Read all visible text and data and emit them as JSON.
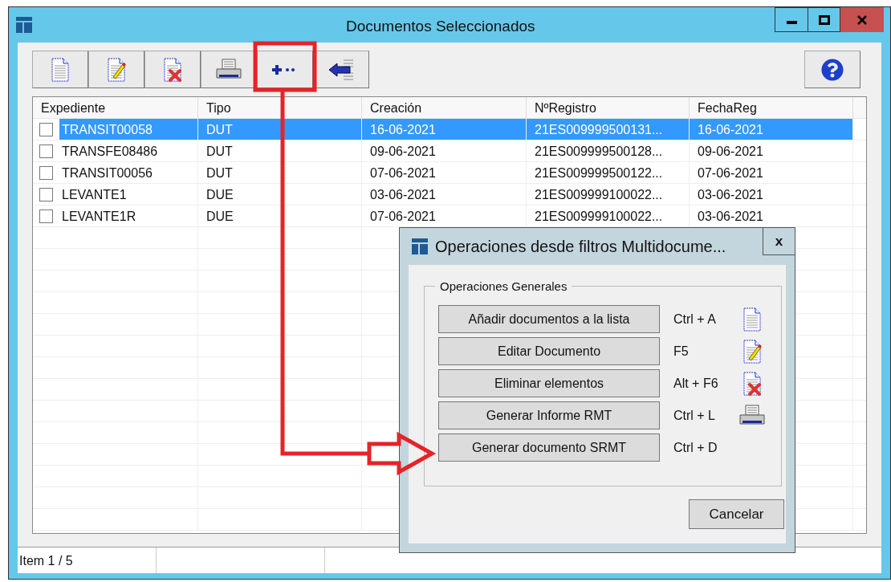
{
  "window": {
    "title": "Documentos Seleccionados"
  },
  "table": {
    "columns": [
      "Expediente",
      "Tipo",
      "Creación",
      "NºRegistro",
      "FechaReg"
    ],
    "rows": [
      {
        "selected": true,
        "checked": false,
        "cells": [
          "TRANSIT00058",
          "DUT",
          "16-06-2021",
          "21ES009999500131...",
          "16-06-2021"
        ]
      },
      {
        "selected": false,
        "checked": false,
        "cells": [
          "TRANSFE08486",
          "DUT",
          "09-06-2021",
          "21ES009999500128...",
          "09-06-2021"
        ]
      },
      {
        "selected": false,
        "checked": false,
        "cells": [
          "TRANSIT00056",
          "DUT",
          "07-06-2021",
          "21ES009999500122...",
          "07-06-2021"
        ]
      },
      {
        "selected": false,
        "checked": false,
        "cells": [
          "LEVANTE1",
          "DUE",
          "03-06-2021",
          "21ES009999100022...",
          "03-06-2021"
        ]
      },
      {
        "selected": false,
        "checked": false,
        "cells": [
          "LEVANTE1R",
          "DUE",
          "07-06-2021",
          "21ES009999100022...",
          "03-06-2021"
        ]
      }
    ]
  },
  "status_bar": {
    "text": "Item 1 / 5"
  },
  "dialog": {
    "title": "Operaciones desde filtros Multidocume...",
    "close": "x",
    "group_label": "Operaciones Generales",
    "operations": [
      {
        "label": "Añadir documentos a la lista",
        "shortcut": "Ctrl + A"
      },
      {
        "label": "Editar Documento",
        "shortcut": "F5"
      },
      {
        "label": "Eliminar elementos",
        "shortcut": "Alt + F6"
      },
      {
        "label": "Generar Informe RMT",
        "shortcut": "Ctrl + L"
      },
      {
        "label": "Generar documento SRMT",
        "shortcut": "Ctrl + D"
      }
    ],
    "cancel": "Cancelar"
  }
}
